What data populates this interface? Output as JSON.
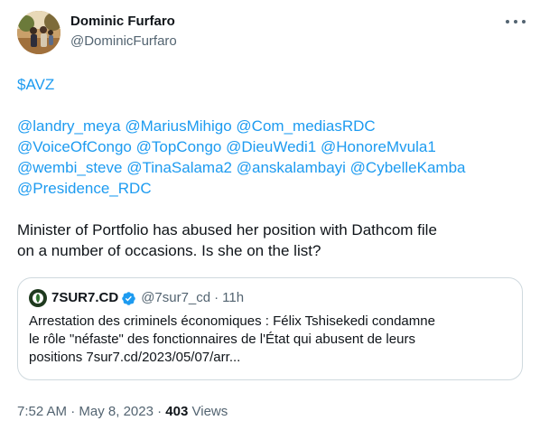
{
  "author": {
    "display_name": "Dominic Furfaro",
    "handle": "@DominicFurfaro",
    "avatar_icon": "profile-photo"
  },
  "tweet": {
    "cashtag": "$AVZ",
    "mentions": [
      "@landry_meya",
      "@MariusMihigo",
      "@Com_mediasRDC",
      "@VoiceOfCongo",
      "@TopCongo",
      "@DieuWedi1",
      "@HonoreMvula1",
      "@wembi_steve",
      "@TinaSalama2",
      "@anskalambayi",
      "@CybelleKamba",
      "@Presidence_RDC"
    ],
    "text_line1": "Minister of Portfolio has abused her position with Dathcom file",
    "text_line2": "on a number of occasions. Is she on the list?"
  },
  "quote": {
    "name": "7SUR7.CD",
    "handle": "@7sur7_cd",
    "separator": "·",
    "time": "11h",
    "text_line1": "Arrestation des criminels économiques : Félix Tshisekedi condamne",
    "text_line2": "le rôle \"néfaste\" des fonctionnaires de l'État qui abusent de leurs",
    "text_line3": "positions 7sur7.cd/2023/05/07/arr..."
  },
  "footer": {
    "time": "7:52 AM",
    "dot1": "·",
    "date": "May 8, 2023",
    "dot2": "·",
    "views_count": "403",
    "views_label": "Views"
  },
  "colors": {
    "link": "#1d9bf0",
    "secondary_text": "#536471",
    "border": "#cfd9de",
    "verified": "#1d9bf0"
  }
}
